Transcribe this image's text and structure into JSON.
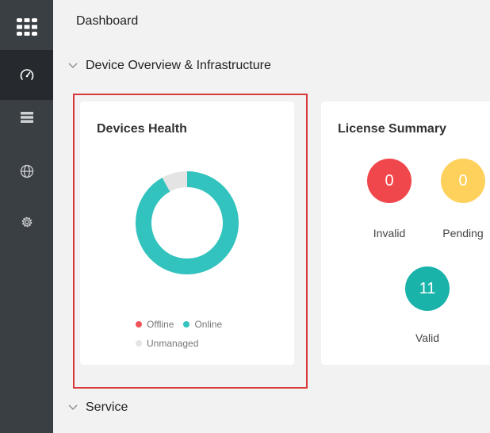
{
  "sidebar": {
    "items": [
      {
        "name": "logo-icon"
      },
      {
        "name": "dashboard-icon",
        "active": true
      },
      {
        "name": "devices-icon"
      },
      {
        "name": "globe-icon"
      },
      {
        "name": "gear-icon"
      }
    ]
  },
  "page": {
    "title": "Dashboard"
  },
  "sections": [
    {
      "label": "Device Overview & Infrastructure",
      "expanded": true
    },
    {
      "label": "Service",
      "expanded": false
    }
  ],
  "devices_health": {
    "title": "Devices Health",
    "legend": {
      "offline": "Offline",
      "online": "Online",
      "unmanaged": "Unmanaged"
    },
    "colors": {
      "offline": "#f0545a",
      "online": "#33c3be",
      "unmanaged": "#e4e4e4"
    },
    "chart_data": {
      "type": "pie",
      "title": "",
      "categories": [
        "Offline",
        "Online",
        "Unmanaged"
      ],
      "values": [
        0,
        92,
        8
      ]
    }
  },
  "license_summary": {
    "title": "License Summary",
    "items": [
      {
        "label": "Invalid",
        "count": "0",
        "color": "#f0474c"
      },
      {
        "label": "Pending",
        "count": "0",
        "color": "#fdd15b"
      },
      {
        "label": "Valid",
        "count": "11",
        "color": "#19b3aa"
      }
    ]
  }
}
